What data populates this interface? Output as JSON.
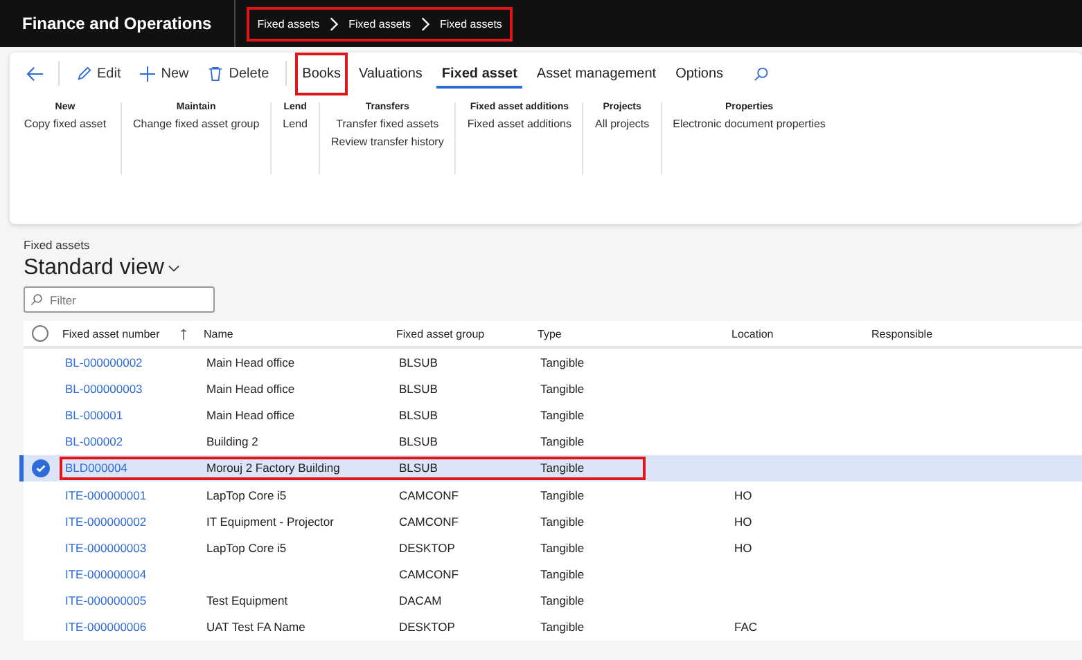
{
  "app_bar": {
    "title": "Finance and Operations",
    "breadcrumb": [
      "Fixed assets",
      "Fixed assets",
      "Fixed assets"
    ],
    "breadcrumb_highlighted": true
  },
  "action_bar": {
    "items": [
      {
        "label": "Edit",
        "kind": "edit",
        "selected": false,
        "highlighted": false
      },
      {
        "label": "New",
        "kind": "new",
        "selected": false,
        "highlighted": false
      },
      {
        "label": "Delete",
        "kind": "delete",
        "selected": false,
        "highlighted": false
      },
      {
        "label": "Books",
        "kind": "tab",
        "selected": false,
        "highlighted": true
      },
      {
        "label": "Valuations",
        "kind": "tab",
        "selected": false,
        "highlighted": false
      },
      {
        "label": "Fixed asset",
        "kind": "tab",
        "selected": true,
        "highlighted": false
      },
      {
        "label": "Asset management",
        "kind": "tab",
        "selected": false,
        "highlighted": false
      },
      {
        "label": "Options",
        "kind": "tab",
        "selected": false,
        "highlighted": false
      }
    ]
  },
  "ribbon": [
    {
      "title": "New",
      "items": [
        "Copy fixed asset"
      ]
    },
    {
      "title": "Maintain",
      "items": [
        "Change fixed asset group"
      ]
    },
    {
      "title": "Lend",
      "items": [
        "Lend"
      ]
    },
    {
      "title": "Transfers",
      "items": [
        "Transfer fixed assets",
        "Review transfer history"
      ]
    },
    {
      "title": "Fixed asset additions",
      "items": [
        "Fixed asset additions"
      ]
    },
    {
      "title": "Projects",
      "items": [
        "All projects"
      ]
    },
    {
      "title": "Properties",
      "items": [
        "Electronic document properties"
      ]
    }
  ],
  "page": {
    "caption": "Fixed assets",
    "view": "Standard view",
    "filter": {
      "placeholder": "Filter"
    }
  },
  "table": {
    "select_all_checked": false,
    "columns": [
      "Fixed asset number",
      "Name",
      "Fixed asset group",
      "Type",
      "Location",
      "Responsible"
    ],
    "rows": [
      {
        "cells": [
          "BL-000000002",
          "Main Head office",
          "BLSUB",
          "Tangible",
          "",
          ""
        ],
        "selected": false,
        "highlighted": false
      },
      {
        "cells": [
          "BL-000000003",
          "Main Head office",
          "BLSUB",
          "Tangible",
          "",
          ""
        ],
        "selected": false,
        "highlighted": false
      },
      {
        "cells": [
          "BL-000001",
          "Main Head office",
          "BLSUB",
          "Tangible",
          "",
          ""
        ],
        "selected": false,
        "highlighted": false
      },
      {
        "cells": [
          "BL-000002",
          "Building 2",
          "BLSUB",
          "Tangible",
          "",
          ""
        ],
        "selected": false,
        "highlighted": false
      },
      {
        "cells": [
          "BLD000004",
          "Morouj 2 Factory Building",
          "BLSUB",
          "Tangible",
          "",
          ""
        ],
        "selected": true,
        "highlighted": true
      },
      {
        "cells": [
          "ITE-000000001",
          "LapTop Core i5",
          "CAMCONF",
          "Tangible",
          "HO",
          ""
        ],
        "selected": false,
        "highlighted": false
      },
      {
        "cells": [
          "ITE-000000002",
          "IT Equipment - Projector",
          "CAMCONF",
          "Tangible",
          "HO",
          ""
        ],
        "selected": false,
        "highlighted": false
      },
      {
        "cells": [
          "ITE-000000003",
          "LapTop Core i5",
          "DESKTOP",
          "Tangible",
          "HO",
          ""
        ],
        "selected": false,
        "highlighted": false
      },
      {
        "cells": [
          "ITE-000000004",
          "",
          "CAMCONF",
          "Tangible",
          "",
          ""
        ],
        "selected": false,
        "highlighted": false
      },
      {
        "cells": [
          "ITE-000000005",
          "Test Equipment",
          "DACAM",
          "Tangible",
          "",
          ""
        ],
        "selected": false,
        "highlighted": false
      },
      {
        "cells": [
          "ITE-000000006",
          "UAT Test FA Name",
          "DESKTOP",
          "Tangible",
          "FAC",
          ""
        ],
        "selected": false,
        "highlighted": false
      }
    ]
  }
}
